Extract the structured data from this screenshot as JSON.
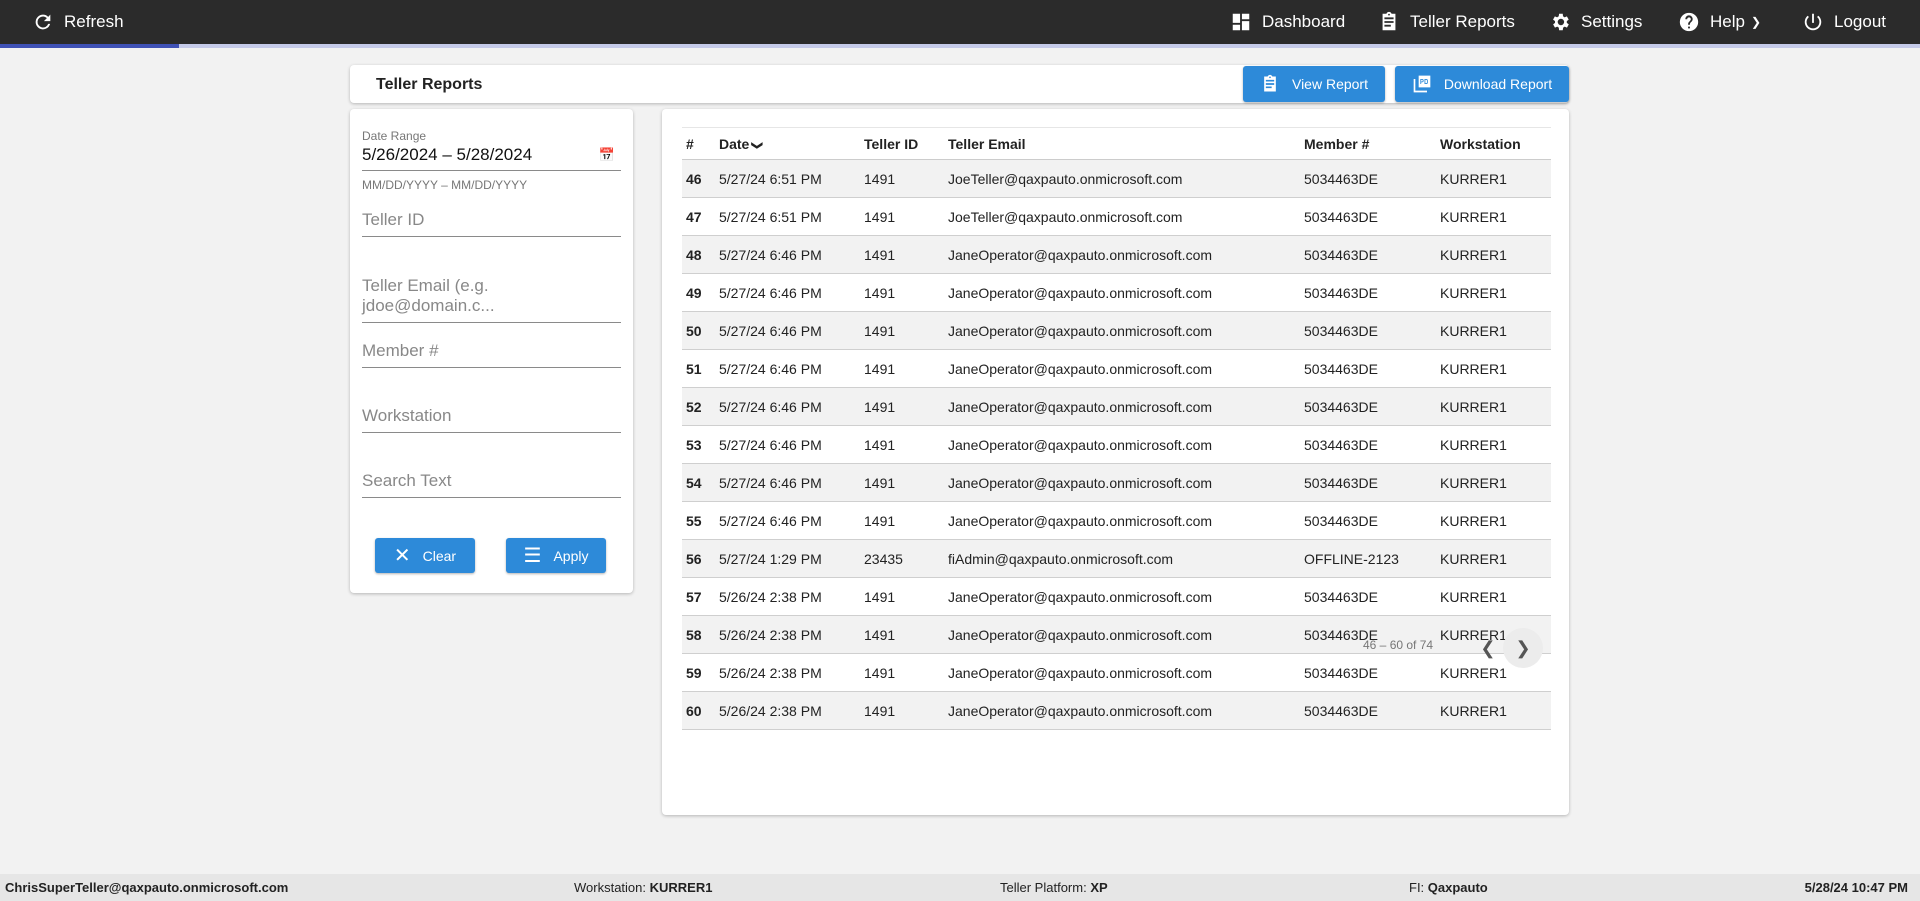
{
  "topbar": {
    "refresh": "Refresh",
    "nav": [
      {
        "label": "Dashboard",
        "icon": "dashboard-icon"
      },
      {
        "label": "Teller Reports",
        "icon": "clipboard-icon"
      },
      {
        "label": "Settings",
        "icon": "gear-icon"
      },
      {
        "label": "Help",
        "icon": "help-icon"
      },
      {
        "label": "Logout",
        "icon": "power-icon"
      }
    ]
  },
  "progress_percent": 9.3,
  "page": {
    "title": "Teller Reports",
    "view_report": "View Report",
    "download_report": "Download Report"
  },
  "filters": {
    "date_range_label": "Date Range",
    "date_range_value": "5/26/2024 – 5/28/2024",
    "date_hint": "MM/DD/YYYY – MM/DD/YYYY",
    "teller_id": "Teller ID",
    "teller_email": "Teller Email (e.g. jdoe@domain.c...",
    "member": "Member #",
    "workstation": "Workstation",
    "search": "Search Text",
    "clear": "Clear",
    "apply": "Apply"
  },
  "table": {
    "headers": [
      "#",
      "Date",
      "Teller ID",
      "Teller Email",
      "Member #",
      "Workstation"
    ],
    "rows": [
      [
        "46",
        "5/27/24 6:51 PM",
        "1491",
        "JoeTeller@qaxpauto.onmicrosoft.com",
        "5034463DE",
        "KURRER1"
      ],
      [
        "47",
        "5/27/24 6:51 PM",
        "1491",
        "JoeTeller@qaxpauto.onmicrosoft.com",
        "5034463DE",
        "KURRER1"
      ],
      [
        "48",
        "5/27/24 6:46 PM",
        "1491",
        "JaneOperator@qaxpauto.onmicrosoft.com",
        "5034463DE",
        "KURRER1"
      ],
      [
        "49",
        "5/27/24 6:46 PM",
        "1491",
        "JaneOperator@qaxpauto.onmicrosoft.com",
        "5034463DE",
        "KURRER1"
      ],
      [
        "50",
        "5/27/24 6:46 PM",
        "1491",
        "JaneOperator@qaxpauto.onmicrosoft.com",
        "5034463DE",
        "KURRER1"
      ],
      [
        "51",
        "5/27/24 6:46 PM",
        "1491",
        "JaneOperator@qaxpauto.onmicrosoft.com",
        "5034463DE",
        "KURRER1"
      ],
      [
        "52",
        "5/27/24 6:46 PM",
        "1491",
        "JaneOperator@qaxpauto.onmicrosoft.com",
        "5034463DE",
        "KURRER1"
      ],
      [
        "53",
        "5/27/24 6:46 PM",
        "1491",
        "JaneOperator@qaxpauto.onmicrosoft.com",
        "5034463DE",
        "KURRER1"
      ],
      [
        "54",
        "5/27/24 6:46 PM",
        "1491",
        "JaneOperator@qaxpauto.onmicrosoft.com",
        "5034463DE",
        "KURRER1"
      ],
      [
        "55",
        "5/27/24 6:46 PM",
        "1491",
        "JaneOperator@qaxpauto.onmicrosoft.com",
        "5034463DE",
        "KURRER1"
      ],
      [
        "56",
        "5/27/24 1:29 PM",
        "23435",
        "fiAdmin@qaxpauto.onmicrosoft.com",
        "OFFLINE-2123",
        "KURRER1"
      ],
      [
        "57",
        "5/26/24 2:38 PM",
        "1491",
        "JaneOperator@qaxpauto.onmicrosoft.com",
        "5034463DE",
        "KURRER1"
      ],
      [
        "58",
        "5/26/24 2:38 PM",
        "1491",
        "JaneOperator@qaxpauto.onmicrosoft.com",
        "5034463DE",
        "KURRER1"
      ],
      [
        "59",
        "5/26/24 2:38 PM",
        "1491",
        "JaneOperator@qaxpauto.onmicrosoft.com",
        "5034463DE",
        "KURRER1"
      ],
      [
        "60",
        "5/26/24 2:38 PM",
        "1491",
        "JaneOperator@qaxpauto.onmicrosoft.com",
        "5034463DE",
        "KURRER1"
      ]
    ]
  },
  "pagination": {
    "range": "46 – 60 of 74"
  },
  "footer": {
    "user": "ChrisSuperTeller@qaxpauto.onmicrosoft.com",
    "workstation_label": "Workstation: ",
    "workstation": "KURRER1",
    "platform_label": "Teller Platform: ",
    "platform": "XP",
    "fi_label": "FI: ",
    "fi": "Qaxpauto",
    "datetime": "5/28/24 10:47 PM"
  },
  "colors": {
    "accent": "#2d8ad9",
    "topbar": "#2b2b2b",
    "progress": "#3f51b5"
  }
}
